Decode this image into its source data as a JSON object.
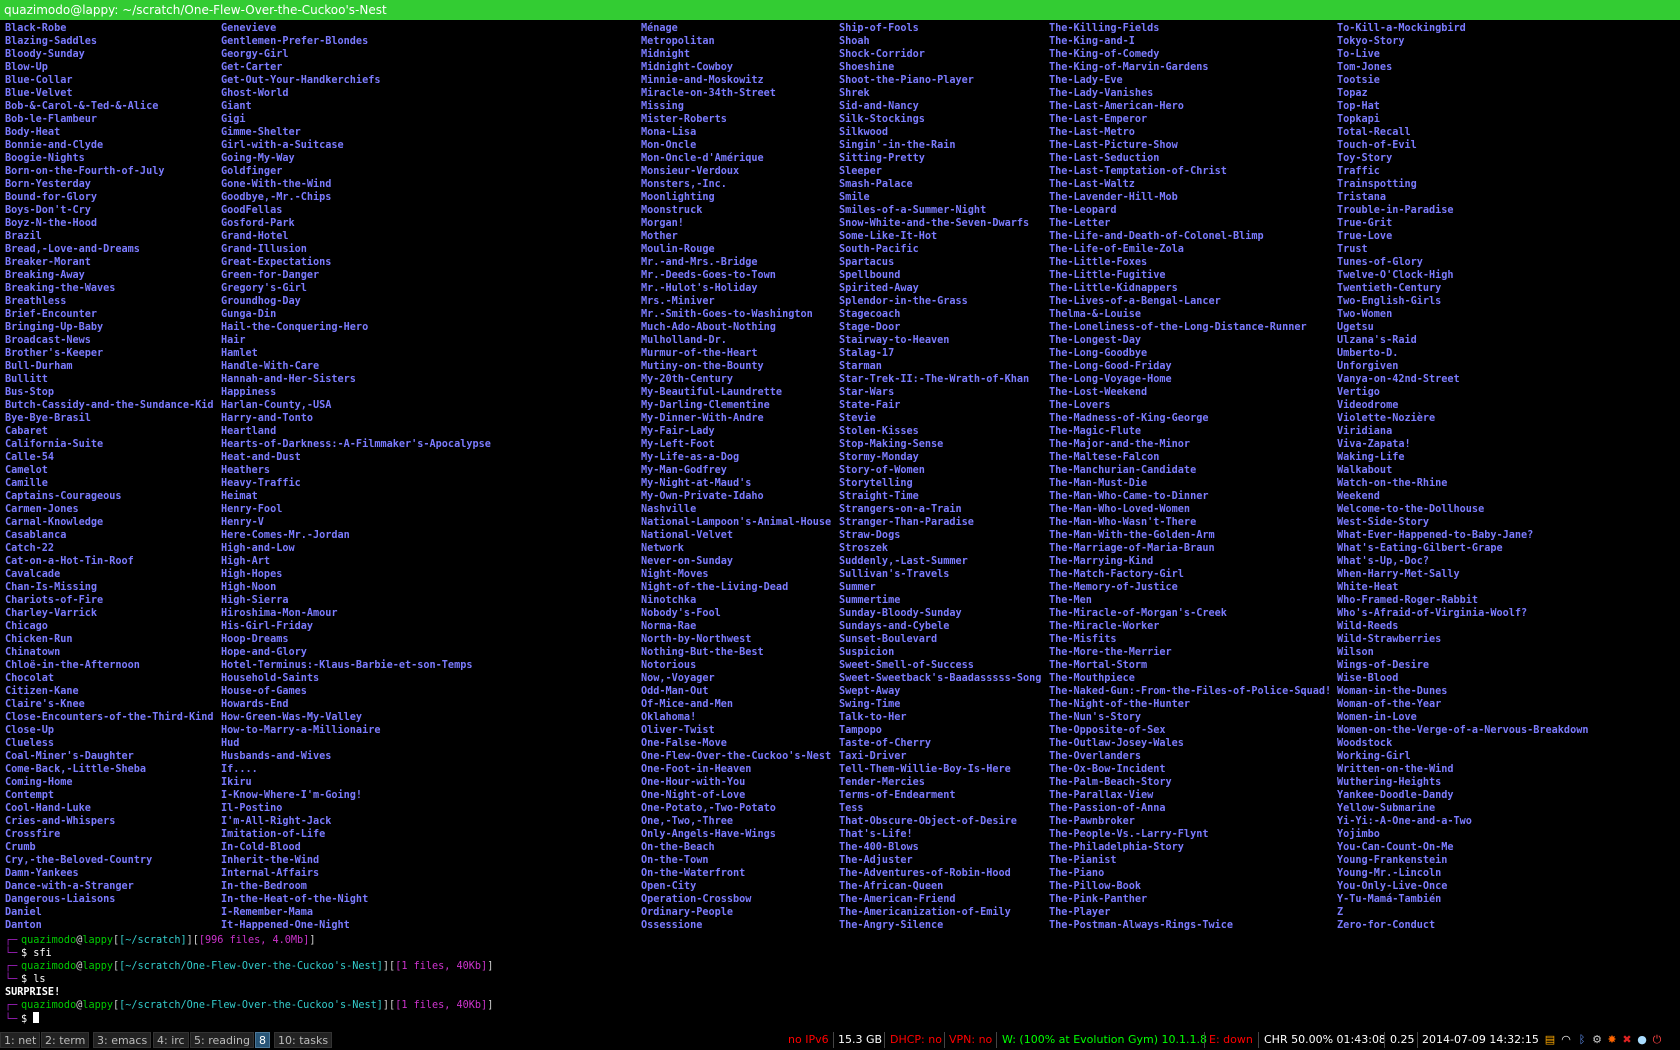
{
  "window": {
    "title": "quazimodo@lappy: ~/scratch/One-Flew-Over-the-Cuckoo's-Nest"
  },
  "listing": {
    "columns": [
      [
        "Black-Robe",
        "Blazing-Saddles",
        "Bloody-Sunday",
        "Blow-Up",
        "Blue-Collar",
        "Blue-Velvet",
        "Bob-&-Carol-&-Ted-&-Alice",
        "Bob-le-Flambeur",
        "Body-Heat",
        "Bonnie-and-Clyde",
        "Boogie-Nights",
        "Born-on-the-Fourth-of-July",
        "Born-Yesterday",
        "Bound-for-Glory",
        "Boys-Don't-Cry",
        "Boyz-N-the-Hood",
        "Brazil",
        "Bread,-Love-and-Dreams",
        "Breaker-Morant",
        "Breaking-Away",
        "Breaking-the-Waves",
        "Breathless",
        "Brief-Encounter",
        "Bringing-Up-Baby",
        "Broadcast-News",
        "Brother's-Keeper",
        "Bull-Durham",
        "Bullitt",
        "Bus-Stop",
        "Butch-Cassidy-and-the-Sundance-Kid",
        "Bye-Bye-Brasil",
        "Cabaret",
        "California-Suite",
        "Calle-54",
        "Camelot",
        "Camille",
        "Captains-Courageous",
        "Carmen-Jones",
        "Carnal-Knowledge",
        "Casablanca",
        "Catch-22",
        "Cat-on-a-Hot-Tin-Roof",
        "Cavalcade",
        "Chan-Is-Missing",
        "Chariots-of-Fire",
        "Charley-Varrick",
        "Chicago",
        "Chicken-Run",
        "Chinatown",
        "Chloë-in-the-Afternoon",
        "Chocolat",
        "Citizen-Kane",
        "Claire's-Knee",
        "Close-Encounters-of-the-Third-Kind",
        "Close-Up",
        "Clueless",
        "Coal-Miner's-Daughter",
        "Come-Back,-Little-Sheba",
        "Coming-Home",
        "Contempt",
        "Cool-Hand-Luke",
        "Cries-and-Whispers",
        "Crossfire",
        "Crumb",
        "Cry,-the-Beloved-Country",
        "Damn-Yankees",
        "Dance-with-a-Stranger",
        "Dangerous-Liaisons",
        "Daniel",
        "Danton"
      ],
      [
        "Genevieve",
        "Gentlemen-Prefer-Blondes",
        "Georgy-Girl",
        "Get-Carter",
        "Get-Out-Your-Handkerchiefs",
        "Ghost-World",
        "Giant",
        "Gigi",
        "Gimme-Shelter",
        "Girl-with-a-Suitcase",
        "Going-My-Way",
        "Goldfinger",
        "Gone-With-the-Wind",
        "Goodbye,-Mr.-Chips",
        "GoodFellas",
        "Gosford-Park",
        "Grand-Hotel",
        "Grand-Illusion",
        "Great-Expectations",
        "Green-for-Danger",
        "Gregory's-Girl",
        "Groundhog-Day",
        "Gunga-Din",
        "Hail-the-Conquering-Hero",
        "Hair",
        "Hamlet",
        "Handle-With-Care",
        "Hannah-and-Her-Sisters",
        "Happiness",
        "Harlan-County,-USA",
        "Harry-and-Tonto",
        "Heartland",
        "Hearts-of-Darkness:-A-Filmmaker's-Apocalypse",
        "Heat-and-Dust",
        "Heathers",
        "Heavy-Traffic",
        "Heimat",
        "Henry-Fool",
        "Henry-V",
        "Here-Comes-Mr.-Jordan",
        "High-and-Low",
        "High-Art",
        "High-Hopes",
        "High-Noon",
        "High-Sierra",
        "Hiroshima-Mon-Amour",
        "His-Girl-Friday",
        "Hoop-Dreams",
        "Hope-and-Glory",
        "Hotel-Terminus:-Klaus-Barbie-et-son-Temps",
        "Household-Saints",
        "House-of-Games",
        "Howards-End",
        "How-Green-Was-My-Valley",
        "How-to-Marry-a-Millionaire",
        "Hud",
        "Husbands-and-Wives",
        "If....",
        "Ikiru",
        "I-Know-Where-I'm-Going!",
        "Il-Postino",
        "I'm-All-Right-Jack",
        "Imitation-of-Life",
        "In-Cold-Blood",
        "Inherit-the-Wind",
        "Internal-Affairs",
        "In-the-Bedroom",
        "In-the-Heat-of-the-Night",
        "I-Remember-Mama",
        "It-Happened-One-Night"
      ],
      [
        "Ménage",
        "Metropolitan",
        "Midnight",
        "Midnight-Cowboy",
        "Minnie-and-Moskowitz",
        "Miracle-on-34th-Street",
        "Missing",
        "Mister-Roberts",
        "Mona-Lisa",
        "Mon-Oncle",
        "Mon-Oncle-d'Amérique",
        "Monsieur-Verdoux",
        "Monsters,-Inc.",
        "Moonlighting",
        "Moonstruck",
        "Morgan!",
        "Mother",
        "Moulin-Rouge",
        "Mr.-and-Mrs.-Bridge",
        "Mr.-Deeds-Goes-to-Town",
        "Mr.-Hulot's-Holiday",
        "Mrs.-Miniver",
        "Mr.-Smith-Goes-to-Washington",
        "Much-Ado-About-Nothing",
        "Mulholland-Dr.",
        "Murmur-of-the-Heart",
        "Mutiny-on-the-Bounty",
        "My-20th-Century",
        "My-Beautiful-Laundrette",
        "My-Darling-Clementine",
        "My-Dinner-With-Andre",
        "My-Fair-Lady",
        "My-Left-Foot",
        "My-Life-as-a-Dog",
        "My-Man-Godfrey",
        "My-Night-at-Maud's",
        "My-Own-Private-Idaho",
        "Nashville",
        "National-Lampoon's-Animal-House",
        "National-Velvet",
        "Network",
        "Never-on-Sunday",
        "Night-Moves",
        "Night-of-the-Living-Dead",
        "Ninotchka",
        "Nobody's-Fool",
        "Norma-Rae",
        "North-by-Northwest",
        "Nothing-But-the-Best",
        "Notorious",
        "Now,-Voyager",
        "Odd-Man-Out",
        "Of-Mice-and-Men",
        "Oklahoma!",
        "Oliver-Twist",
        "One-False-Move",
        "One-Flew-Over-the-Cuckoo's-Nest",
        "One-Foot-in-Heaven",
        "One-Hour-with-You",
        "One-Night-of-Love",
        "One-Potato,-Two-Potato",
        "One,-Two,-Three",
        "Only-Angels-Have-Wings",
        "On-the-Beach",
        "On-the-Town",
        "On-the-Waterfront",
        "Open-City",
        "Operation-Crossbow",
        "Ordinary-People",
        "Ossessione"
      ],
      [
        "Ship-of-Fools",
        "Shoah",
        "Shock-Corridor",
        "Shoeshine",
        "Shoot-the-Piano-Player",
        "Shrek",
        "Sid-and-Nancy",
        "Silk-Stockings",
        "Silkwood",
        "Singin'-in-the-Rain",
        "Sitting-Pretty",
        "Sleeper",
        "Smash-Palace",
        "Smile",
        "Smiles-of-a-Summer-Night",
        "Snow-White-and-the-Seven-Dwarfs",
        "Some-Like-It-Hot",
        "South-Pacific",
        "Spartacus",
        "Spellbound",
        "Spirited-Away",
        "Splendor-in-the-Grass",
        "Stagecoach",
        "Stage-Door",
        "Stairway-to-Heaven",
        "Stalag-17",
        "Starman",
        "Star-Trek-II:-The-Wrath-of-Khan",
        "Star-Wars",
        "State-Fair",
        "Stevie",
        "Stolen-Kisses",
        "Stop-Making-Sense",
        "Stormy-Monday",
        "Story-of-Women",
        "Storytelling",
        "Straight-Time",
        "Strangers-on-a-Train",
        "Stranger-Than-Paradise",
        "Straw-Dogs",
        "Stroszek",
        "Suddenly,-Last-Summer",
        "Sullivan's-Travels",
        "Summer",
        "Summertime",
        "Sunday-Bloody-Sunday",
        "Sundays-and-Cybele",
        "Sunset-Boulevard",
        "Suspicion",
        "Sweet-Smell-of-Success",
        "Sweet-Sweetback's-Baadasssss-Song",
        "Swept-Away",
        "Swing-Time",
        "Talk-to-Her",
        "Tampopo",
        "Taste-of-Cherry",
        "Taxi-Driver",
        "Tell-Them-Willie-Boy-Is-Here",
        "Tender-Mercies",
        "Terms-of-Endearment",
        "Tess",
        "That-Obscure-Object-of-Desire",
        "That's-Life!",
        "The-400-Blows",
        "The-Adjuster",
        "The-Adventures-of-Robin-Hood",
        "The-African-Queen",
        "The-American-Friend",
        "The-Americanization-of-Emily",
        "The-Angry-Silence"
      ],
      [
        "The-Killing-Fields",
        "The-King-and-I",
        "The-King-of-Comedy",
        "The-King-of-Marvin-Gardens",
        "The-Lady-Eve",
        "The-Lady-Vanishes",
        "The-Last-American-Hero",
        "The-Last-Emperor",
        "The-Last-Metro",
        "The-Last-Picture-Show",
        "The-Last-Seduction",
        "The-Last-Temptation-of-Christ",
        "The-Last-Waltz",
        "The-Lavender-Hill-Mob",
        "The-Leopard",
        "The-Letter",
        "The-Life-and-Death-of-Colonel-Blimp",
        "The-Life-of-Emile-Zola",
        "The-Little-Foxes",
        "The-Little-Fugitive",
        "The-Little-Kidnappers",
        "The-Lives-of-a-Bengal-Lancer",
        "Thelma-&-Louise",
        "The-Loneliness-of-the-Long-Distance-Runner",
        "The-Longest-Day",
        "The-Long-Goodbye",
        "The-Long-Good-Friday",
        "The-Long-Voyage-Home",
        "The-Lost-Weekend",
        "The-Lovers",
        "The-Madness-of-King-George",
        "The-Magic-Flute",
        "The-Major-and-the-Minor",
        "The-Maltese-Falcon",
        "The-Manchurian-Candidate",
        "The-Man-Must-Die",
        "The-Man-Who-Came-to-Dinner",
        "The-Man-Who-Loved-Women",
        "The-Man-Who-Wasn't-There",
        "The-Man-With-the-Golden-Arm",
        "The-Marriage-of-Maria-Braun",
        "The-Marrying-Kind",
        "The-Match-Factory-Girl",
        "The-Memory-of-Justice",
        "The-Men",
        "The-Miracle-of-Morgan's-Creek",
        "The-Miracle-Worker",
        "The-Misfits",
        "The-More-the-Merrier",
        "The-Mortal-Storm",
        "The-Mouthpiece",
        "The-Naked-Gun:-From-the-Files-of-Police-Squad!",
        "The-Night-of-the-Hunter",
        "The-Nun's-Story",
        "The-Opposite-of-Sex",
        "The-Outlaw-Josey-Wales",
        "The-Overlanders",
        "The-Ox-Bow-Incident",
        "The-Palm-Beach-Story",
        "The-Parallax-View",
        "The-Passion-of-Anna",
        "The-Pawnbroker",
        "The-People-Vs.-Larry-Flynt",
        "The-Philadelphia-Story",
        "The-Pianist",
        "The-Piano",
        "The-Pillow-Book",
        "The-Pink-Panther",
        "The-Player",
        "The-Postman-Always-Rings-Twice"
      ],
      [
        "To-Kill-a-Mockingbird",
        "Tokyo-Story",
        "To-Live",
        "Tom-Jones",
        "Tootsie",
        "Topaz",
        "Top-Hat",
        "Topkapi",
        "Total-Recall",
        "Touch-of-Evil",
        "Toy-Story",
        "Traffic",
        "Trainspotting",
        "Tristana",
        "Trouble-in-Paradise",
        "True-Grit",
        "True-Love",
        "Trust",
        "Tunes-of-Glory",
        "Twelve-O'Clock-High",
        "Twentieth-Century",
        "Two-English-Girls",
        "Two-Women",
        "Ugetsu",
        "Ulzana's-Raid",
        "Umberto-D.",
        "Unforgiven",
        "Vanya-on-42nd-Street",
        "Vertigo",
        "Videodrome",
        "Violette-Nozière",
        "Viridiana",
        "Viva-Zapata!",
        "Waking-Life",
        "Walkabout",
        "Watch-on-the-Rhine",
        "Weekend",
        "Welcome-to-the-Dollhouse",
        "West-Side-Story",
        "What-Ever-Happened-to-Baby-Jane?",
        "What's-Eating-Gilbert-Grape",
        "What's-Up,-Doc?",
        "When-Harry-Met-Sally",
        "White-Heat",
        "Who-Framed-Roger-Rabbit",
        "Who's-Afraid-of-Virginia-Woolf?",
        "Wild-Reeds",
        "Wild-Strawberries",
        "Wilson",
        "Wings-of-Desire",
        "Wise-Blood",
        "Woman-in-the-Dunes",
        "Woman-of-the-Year",
        "Women-in-Love",
        "Women-on-the-Verge-of-a-Nervous-Breakdown",
        "Woodstock",
        "Working-Girl",
        "Written-on-the-Wind",
        "Wuthering-Heights",
        "Yankee-Doodle-Dandy",
        "Yellow-Submarine",
        "Yi-Yi:-A-One-and-a-Two",
        "Yojimbo",
        "You-Can-Count-On-Me",
        "Young-Frankenstein",
        "Young-Mr.-Lincoln",
        "You-Only-Live-Once",
        "Y-Tu-Mamá-También",
        "Z",
        "Zero-for-Conduct"
      ]
    ]
  },
  "session": {
    "prompt1": {
      "top": "┌─",
      "user": "quazimodo",
      "at": "@",
      "host": "lappy",
      "path": "[~/scratch]",
      "info": "[996 files, 4.0Mb]",
      "bottom": "└─",
      "sym": "$ ",
      "command": "sfi"
    },
    "prompt2": {
      "top": "┌─",
      "user": "quazimodo",
      "at": "@",
      "host": "lappy",
      "path": "[~/scratch/One-Flew-Over-the-Cuckoo's-Nest]",
      "info": "[1 files, 40Kb]",
      "bottom": "└─",
      "sym": "$ ",
      "command": "ls"
    },
    "output": "SURPRISE!",
    "prompt3": {
      "top": "┌─",
      "user": "quazimodo",
      "at": "@",
      "host": "lappy",
      "path": "[~/scratch/One-Flew-Over-the-Cuckoo's-Nest]",
      "info": "[1 files, 40Kb]",
      "bottom": "└─",
      "sym": "$ ",
      "command": ""
    }
  },
  "statusbar": {
    "workspaces": [
      {
        "label": "1: net",
        "active": false
      },
      {
        "label": "2: term",
        "active": false
      },
      {
        "label": "3: emacs",
        "active": false
      },
      {
        "label": "4: irc",
        "active": false
      },
      {
        "label": "5: reading",
        "active": false
      },
      {
        "label": "8",
        "active": true
      },
      {
        "label": "10: tasks",
        "active": false
      }
    ],
    "ipv6": "no IPv6",
    "disk": "15.3 GB",
    "dhcp": "DHCP: no",
    "vpn": "VPN: no",
    "wifi": "W: (100% at Evolution Gym) 10.1.1.8",
    "eth": "E: down",
    "battery": "CHR 50.00% 01:43:08",
    "load": "0.25",
    "datetime": "2014-07-09 14:32:15",
    "colors": {
      "bad": "#ff0000",
      "good": "#00ff00",
      "neutral": "#ffffff"
    },
    "tray_icons": [
      "calendar-icon",
      "wifi-icon",
      "bluetooth-icon",
      "settings-icon",
      "alert-icon",
      "network-icon",
      "volume-icon",
      "power-icon"
    ]
  }
}
